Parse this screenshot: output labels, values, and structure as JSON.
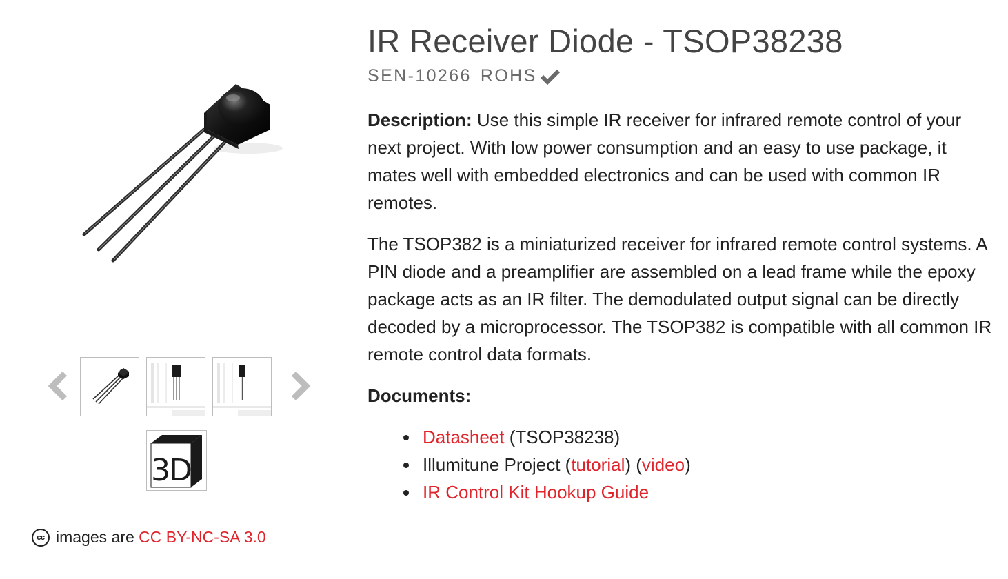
{
  "product": {
    "title": "IR Receiver Diode - TSOP38238",
    "sku": "SEN-10266",
    "rohs_label": "ROHS"
  },
  "description": {
    "label": "Description:",
    "intro": "Use this simple IR receiver for infrared remote control of your next project. With low power consumption and an easy to use package, it mates well with embedded electronics and can be used with common IR remotes.",
    "details": "The TSOP382 is a miniaturized receiver for infrared remote control systems. A PIN diode and a preamplifier are assembled on a lead frame while the epoxy package acts as an IR filter. The demodulated output signal can be directly decoded by a microprocessor. The TSOP382 is compatible with all common IR remote control data formats."
  },
  "documents": {
    "heading": "Documents:",
    "datasheet": {
      "link": "Datasheet",
      "suffix": " (TSOP38238)"
    },
    "illumitune": {
      "prefix": "Illumitune Project (",
      "tutorial_link": "tutorial",
      "middle": ") (",
      "video_link": "video",
      "suffix": ")"
    },
    "hookup_guide": {
      "link": "IR Control Kit Hookup Guide"
    }
  },
  "gallery": {
    "prev_icon": "chevron-left-icon",
    "next_icon": "chevron-right-icon",
    "view_3d_label": "3D"
  },
  "license": {
    "icon_text": "cc",
    "prefix": "images are ",
    "link": "CC BY-NC-SA 3.0"
  },
  "colors": {
    "link": "#e0242b",
    "title": "#444444",
    "sku": "#6b6b6b",
    "body_text": "#222222"
  }
}
